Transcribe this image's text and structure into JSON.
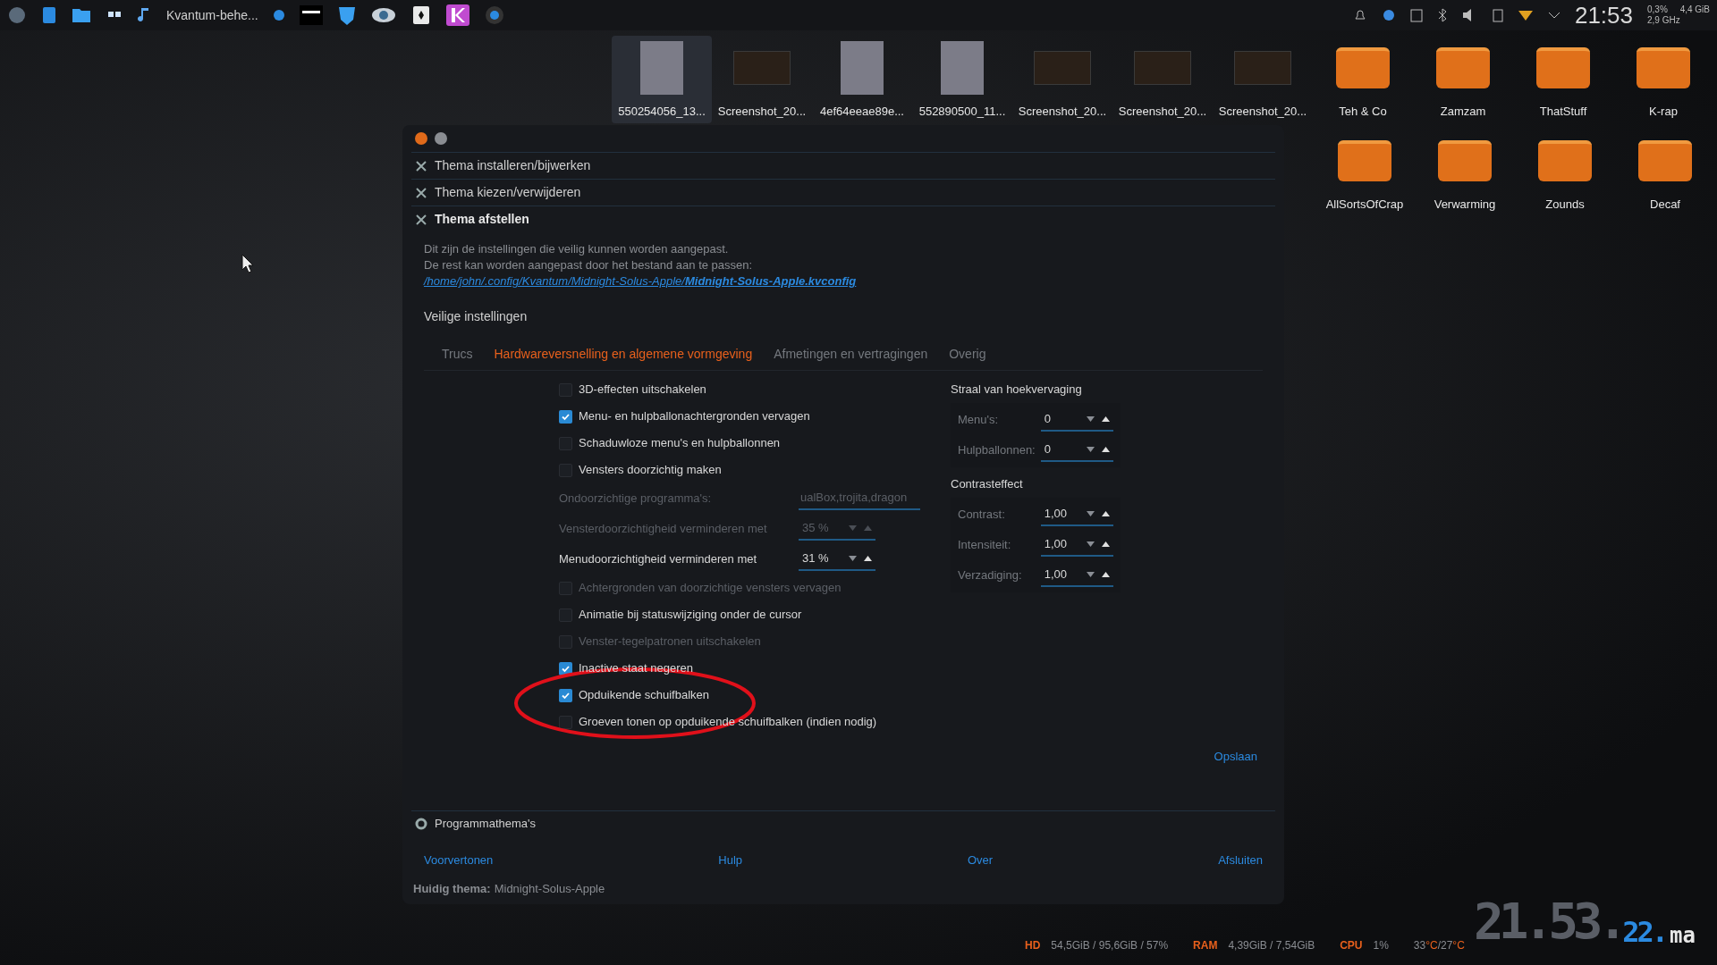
{
  "taskbar": {
    "task_label": "Kvantum-behe...",
    "clock": "21:53",
    "cpu_load": "0,3%",
    "memory": "4,4 GiB",
    "frequency": "2,9 GHz"
  },
  "desktop_icons": [
    {
      "label": "550254056_13...",
      "kind": "photo",
      "selected": true
    },
    {
      "label": "Screenshot_20...",
      "kind": "screenshot",
      "selected": false
    },
    {
      "label": "4ef64eeae89e...",
      "kind": "photo",
      "selected": false
    },
    {
      "label": "552890500_11...",
      "kind": "photo",
      "selected": false
    },
    {
      "label": "Screenshot_20...",
      "kind": "screenshot",
      "selected": false
    },
    {
      "label": "Screenshot_20...",
      "kind": "screenshot",
      "selected": false
    },
    {
      "label": "Screenshot_20...",
      "kind": "screenshot",
      "selected": false
    },
    {
      "label": "Teh & Co",
      "kind": "folder",
      "selected": false
    },
    {
      "label": "Zamzam",
      "kind": "folder",
      "selected": false
    },
    {
      "label": "ThatStuff",
      "kind": "folder",
      "selected": false
    },
    {
      "label": "K-rap",
      "kind": "folder",
      "selected": false
    },
    {
      "label": "AllSortsOfCrap",
      "kind": "folder",
      "selected": false
    },
    {
      "label": "Verwarming",
      "kind": "folder",
      "selected": false
    },
    {
      "label": "Zounds",
      "kind": "folder",
      "selected": false
    },
    {
      "label": "Decaf",
      "kind": "folder",
      "selected": false
    }
  ],
  "window": {
    "sections": [
      {
        "label": "Thema installeren/bijwerken",
        "expanded": false
      },
      {
        "label": "Thema kiezen/verwijderen",
        "expanded": false
      },
      {
        "label": "Thema afstellen",
        "expanded": true
      }
    ],
    "description": [
      "Dit zijn de instellingen die veilig kunnen worden aangepast.",
      "De rest kan worden aangepast door het bestand aan te passen:"
    ],
    "config_path": "/home/john/.config/Kvantum/Midnight-Solus-Apple/**Midnight-Solus-Apple.kvconfig**",
    "safe_settings_title": "Veilige instellingen",
    "tabs": [
      {
        "label": "Trucs",
        "selected": false
      },
      {
        "label": "Hardwareversnelling en algemene vormgeving",
        "selected": true
      },
      {
        "label": "Afmetingen en vertragingen",
        "selected": false
      },
      {
        "label": "Overig",
        "selected": false
      }
    ],
    "options": [
      {
        "kind": "checkbox",
        "label": "3D-effecten uitschakelen",
        "checked": false,
        "disabled": false
      },
      {
        "kind": "checkbox",
        "label": "Menu- en hulpballonachtergronden vervagen",
        "checked": true,
        "disabled": false
      },
      {
        "kind": "checkbox",
        "label": "Schaduwloze menu's en hulpballonnen",
        "checked": false,
        "disabled": false
      },
      {
        "kind": "checkbox",
        "label": "Vensters doorzichtig maken",
        "checked": false,
        "disabled": false
      },
      {
        "kind": "text",
        "label": "Ondoorzichtige programma's:",
        "value": "ualBox,trojita,dragon",
        "disabled": true
      },
      {
        "kind": "spin",
        "label": "Vensterdoorzichtigheid verminderen met",
        "value": "35 %",
        "disabled": true
      },
      {
        "kind": "spin",
        "label": "Menudoorzichtigheid verminderen met",
        "value": "31 %",
        "disabled": false
      },
      {
        "kind": "subcheckbox",
        "label": "Achtergronden van doorzichtige vensters vervagen",
        "checked": false,
        "disabled": true
      },
      {
        "kind": "checkbox",
        "label": "Animatie bij statuswijziging onder de cursor",
        "checked": false,
        "disabled": false
      },
      {
        "kind": "checkbox",
        "label": "Venster-tegelpatronen uitschakelen",
        "checked": false,
        "disabled": true
      },
      {
        "kind": "checkbox",
        "label": "Inactive staat negeren",
        "checked": true,
        "disabled": false
      },
      {
        "kind": "checkbox",
        "label": "Opduikende schuifbalken",
        "checked": true,
        "disabled": false
      },
      {
        "kind": "checkbox",
        "label": "Groeven tonen op opduikende schuifbalken (indien nodig)",
        "checked": false,
        "disabled": false
      }
    ],
    "right_groups": [
      {
        "title": "Straal van hoekvervaging",
        "fields": [
          {
            "label": "Menu's:",
            "value": "0"
          },
          {
            "label": "Hulpballonnen:",
            "value": "0"
          }
        ]
      },
      {
        "title": "Contrasteffect",
        "fields": [
          {
            "label": "Contrast:",
            "value": "1,00"
          },
          {
            "label": "Intensiteit:",
            "value": "1,00"
          },
          {
            "label": "Verzadiging:",
            "value": "1,00"
          }
        ]
      }
    ],
    "save_button": "Opslaan",
    "app_themes_section": "Programmathema's",
    "footer_buttons": [
      "Voorvertonen",
      "Hulp",
      "Over",
      "Afsluiten"
    ],
    "current_theme_label": "Huidig thema:",
    "current_theme": "Midnight-Solus-Apple"
  },
  "system_monitor": [
    {
      "label": "HD",
      "value": "54,5GiB / 95,6GiB / 57%"
    },
    {
      "label": "RAM",
      "value": "4,39GiB / 7,54GiB"
    },
    {
      "label": "CPU",
      "value": "1%"
    }
  ],
  "temperature": [
    {
      "value": "33",
      "unit": "°C"
    },
    {
      "value": "/27",
      "unit": "°C"
    }
  ],
  "desktop_clock": {
    "hours_minutes": "21.53.",
    "seconds": "22.",
    "day": "ma"
  }
}
